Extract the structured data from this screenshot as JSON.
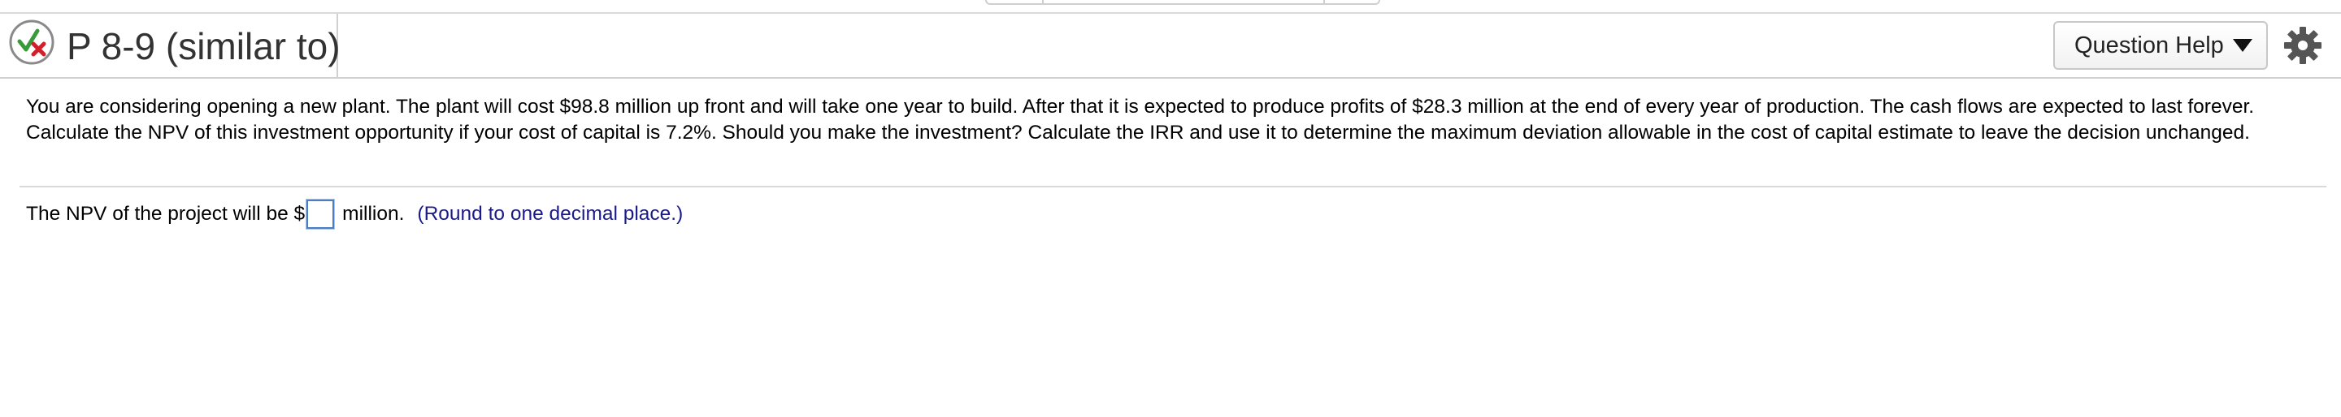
{
  "header": {
    "title": "P 8-9 (similar to)",
    "status_icon": "partial-credit-check-x-icon",
    "help_button_label": "Question Help",
    "help_caret_icon": "caret-down-icon",
    "settings_icon": "gear-icon"
  },
  "question": {
    "text": "You are considering opening a new plant. The plant will cost $98.8 million up front and will take one year to build. After that it is expected to produce profits of $28.3 million at the end of every year of production. The cash flows are expected to last forever. Calculate the NPV of this investment opportunity if your cost of capital is 7.2%. Should you make the investment? Calculate the IRR and use it to determine the maximum deviation allowable in the cost of capital estimate to leave the decision unchanged."
  },
  "answer": {
    "prefix": "The NPV of the project will be $",
    "value": "",
    "suffix": "million.",
    "hint": "(Round to one decimal place.)"
  },
  "colors": {
    "check_green": "#3a9a3a",
    "x_red": "#d0202a",
    "hint_blue": "#1a1a8c",
    "input_border": "#4a7fc4"
  }
}
